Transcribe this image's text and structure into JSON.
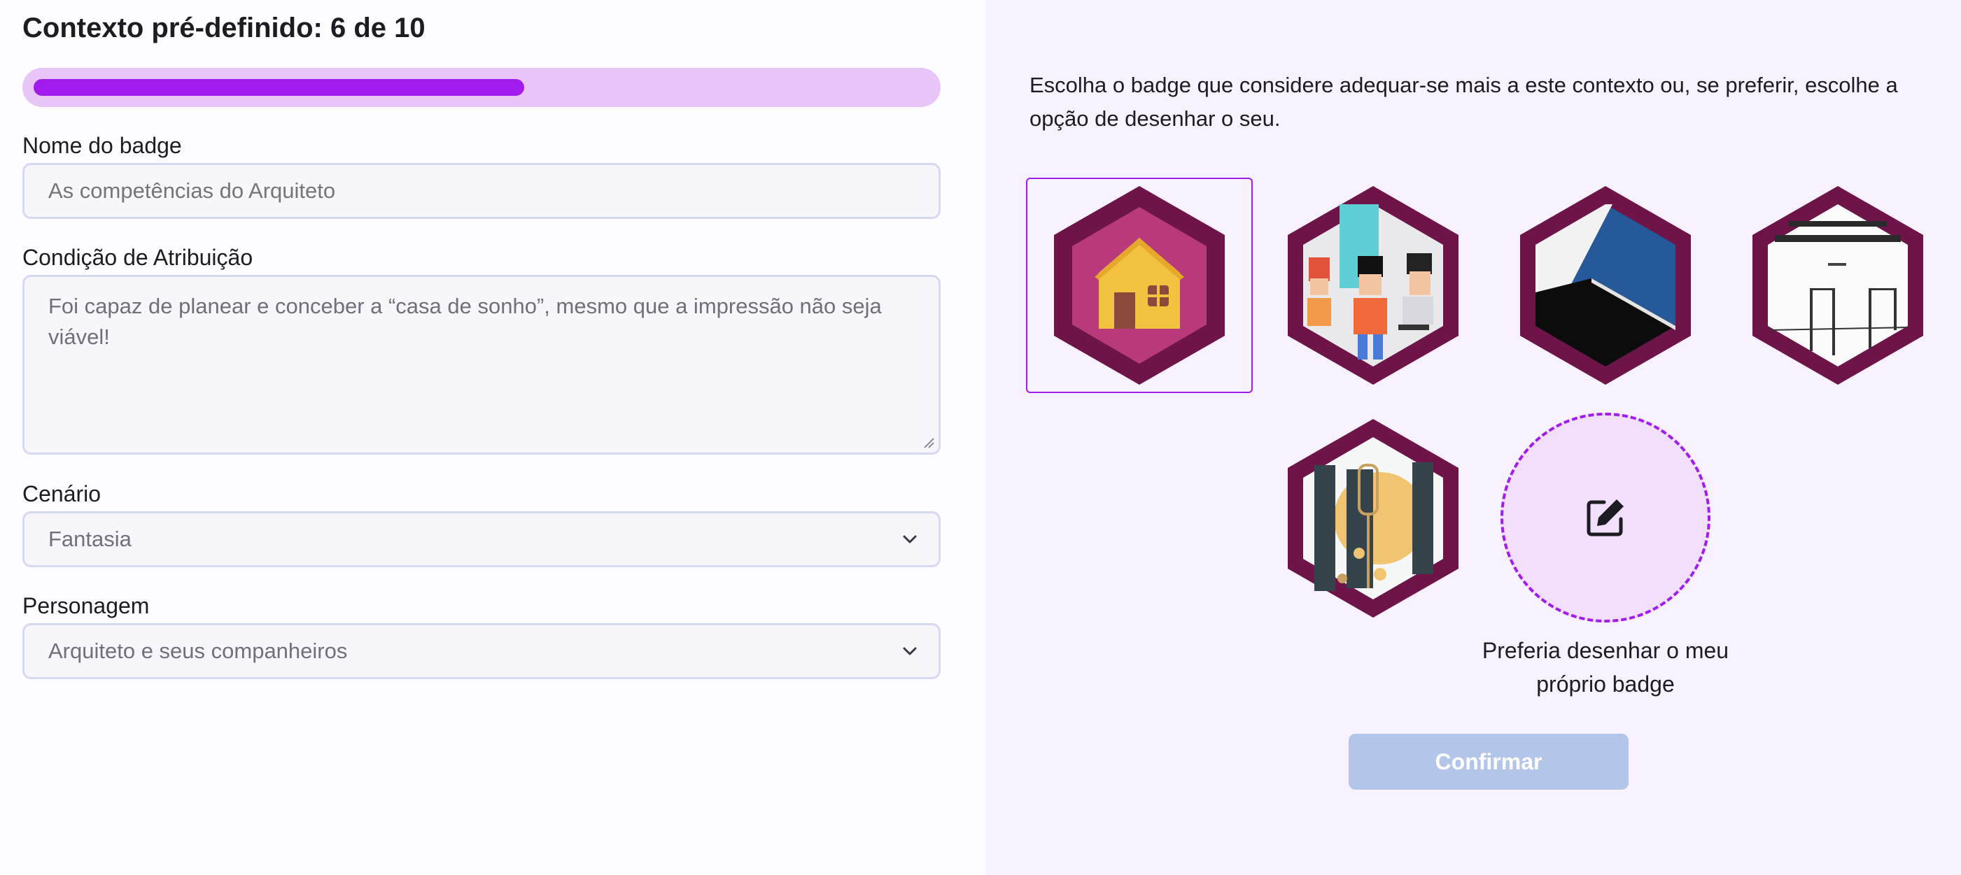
{
  "header": {
    "title": "Contexto pré-definido: 6 de 10"
  },
  "progress": {
    "current": 6,
    "total": 10,
    "fraction": 0.6
  },
  "form": {
    "badge_name": {
      "label": "Nome do badge",
      "placeholder": "As competências do Arquiteto"
    },
    "condition": {
      "label": "Condição de Atribuição",
      "value": "Foi capaz de planear e conceber a “casa de sonho”, mesmo que a impressão não seja viável!"
    },
    "scenario": {
      "label": "Cenário",
      "value": "Fantasia"
    },
    "character": {
      "label": "Personagem",
      "value": "Arquiteto e seus companheiros"
    }
  },
  "badges": {
    "instructions": "Escolha o badge que considere adequar-se mais a este contexto ou, se preferir, escolhe a opção de desenhar o seu.",
    "options": [
      {
        "name": "house-badge",
        "selected": true
      },
      {
        "name": "people-badge",
        "selected": false
      },
      {
        "name": "abstract-blue-badge",
        "selected": false
      },
      {
        "name": "text-sketch-badge",
        "selected": false
      },
      {
        "name": "construction-badge",
        "selected": false
      }
    ],
    "draw_own_label": "Preferia desenhar o meu próprio badge"
  },
  "actions": {
    "confirm_label": "Confirmar"
  },
  "colors": {
    "accent": "#a21ced",
    "progress_track": "#e8c6f7",
    "hex_frame": "#6e1449",
    "confirm_disabled": "#b3c6ea"
  }
}
